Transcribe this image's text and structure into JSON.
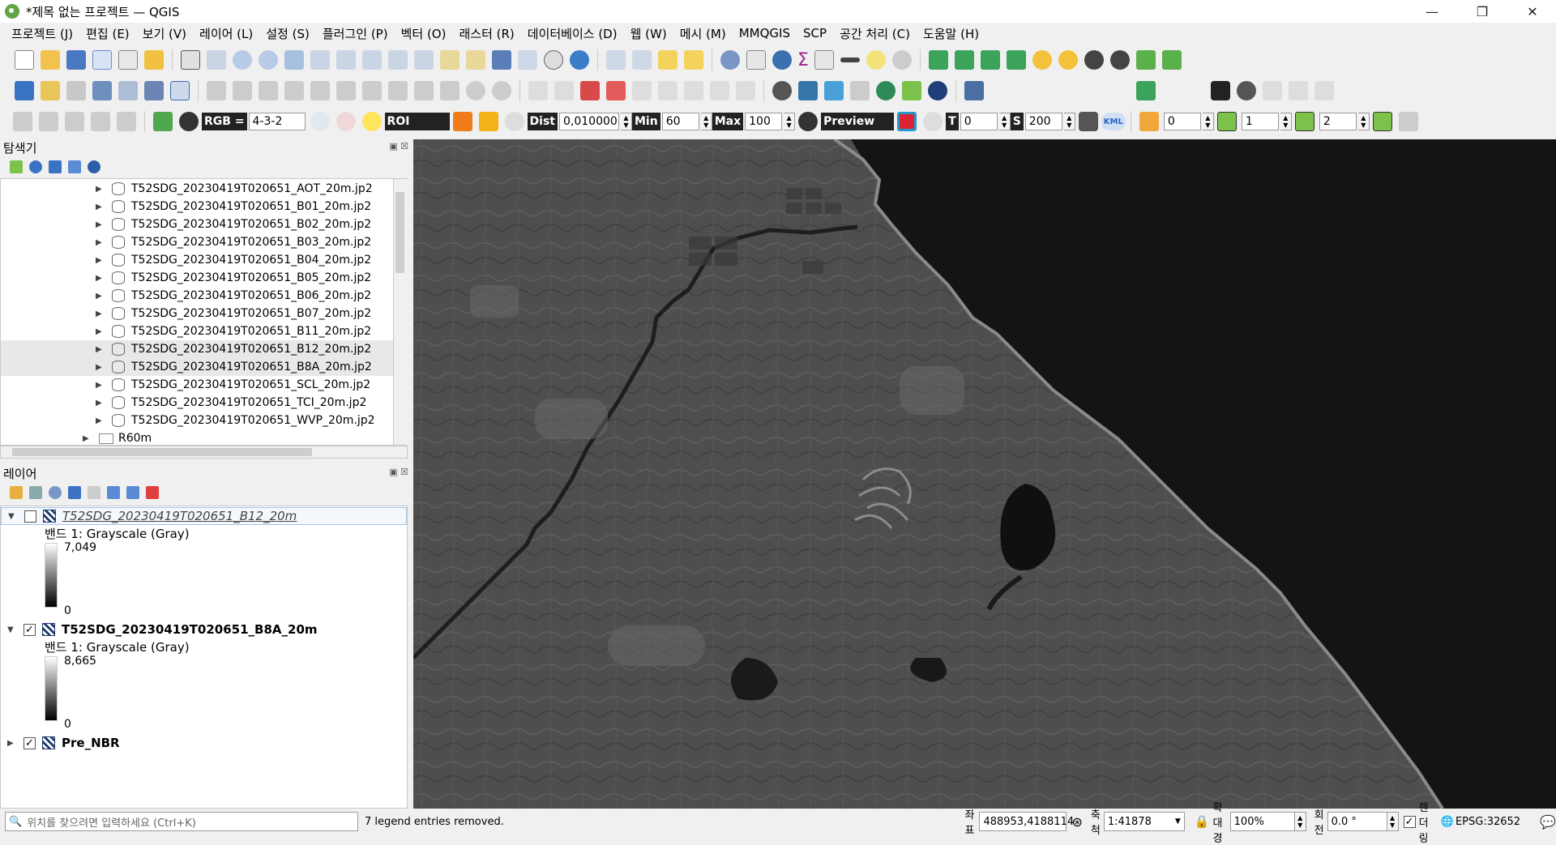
{
  "window": {
    "title": "*제목 없는 프로젝트 — QGIS",
    "minimize": "—",
    "restore": "❐",
    "close": "✕"
  },
  "menu": [
    "프로젝트 (J)",
    "편집 (E)",
    "보기 (V)",
    "레이어 (L)",
    "설정 (S)",
    "플러그인 (P)",
    "벡터 (O)",
    "래스터 (R)",
    "데이터베이스 (D)",
    "웹 (W)",
    "메시 (M)",
    "MMQGIS",
    "SCP",
    "공간 처리 (C)",
    "도움말 (H)"
  ],
  "scp_toolbar": {
    "rgb_label": "RGB =",
    "rgb_value": "4-3-2",
    "roi_label": "ROI",
    "dist_label": "Dist",
    "dist_value": "0,010000",
    "min_label": "Min",
    "min_value": "60",
    "max_label": "Max",
    "max_value": "100",
    "preview_label": "Preview",
    "t_label": "T",
    "t_value": "0",
    "s_label": "S",
    "s_value": "200",
    "kml_label": "KML",
    "f1_value": "0",
    "f2_value": "1",
    "f3_value": "2"
  },
  "browser": {
    "title": "탐색기",
    "items": [
      {
        "label": "T52SDG_20230419T020651_AOT_20m.jp2"
      },
      {
        "label": "T52SDG_20230419T020651_B01_20m.jp2"
      },
      {
        "label": "T52SDG_20230419T020651_B02_20m.jp2"
      },
      {
        "label": "T52SDG_20230419T020651_B03_20m.jp2"
      },
      {
        "label": "T52SDG_20230419T020651_B04_20m.jp2"
      },
      {
        "label": "T52SDG_20230419T020651_B05_20m.jp2"
      },
      {
        "label": "T52SDG_20230419T020651_B06_20m.jp2"
      },
      {
        "label": "T52SDG_20230419T020651_B07_20m.jp2"
      },
      {
        "label": "T52SDG_20230419T020651_B11_20m.jp2"
      },
      {
        "label": "T52SDG_20230419T020651_B12_20m.jp2"
      },
      {
        "label": "T52SDG_20230419T020651_B8A_20m.jp2"
      },
      {
        "label": "T52SDG_20230419T020651_SCL_20m.jp2"
      },
      {
        "label": "T52SDG_20230419T020651_TCI_20m.jp2"
      },
      {
        "label": "T52SDG_20230419T020651_WVP_20m.jp2"
      }
    ],
    "folder": "R60m"
  },
  "layers": {
    "title": "레이어",
    "items": [
      {
        "name": "T52SDG_20230419T020651_B12_20m",
        "band": "밴드 1: Grayscale (Gray)",
        "max": "7,049",
        "min": "0",
        "checked": ""
      },
      {
        "name": "T52SDG_20230419T020651_B8A_20m",
        "band": "밴드 1: Grayscale (Gray)",
        "max": "8,665",
        "min": "0",
        "checked": "✓"
      },
      {
        "name": "Pre_NBR",
        "checked": "✓"
      }
    ]
  },
  "status": {
    "search_placeholder": "위치를 찾으려면 입력하세요 (Ctrl+K)",
    "message": "7 legend entries removed.",
    "coord_label": "좌표",
    "coord_value": "488953,4188114",
    "scale_label": "축척",
    "scale_value": "1:41878",
    "magnifier_label": "확대경",
    "magnifier_value": "100%",
    "rotation_label": "회전",
    "rotation_value": "0.0 °",
    "render_label": "렌더링",
    "crs": "EPSG:32652"
  }
}
